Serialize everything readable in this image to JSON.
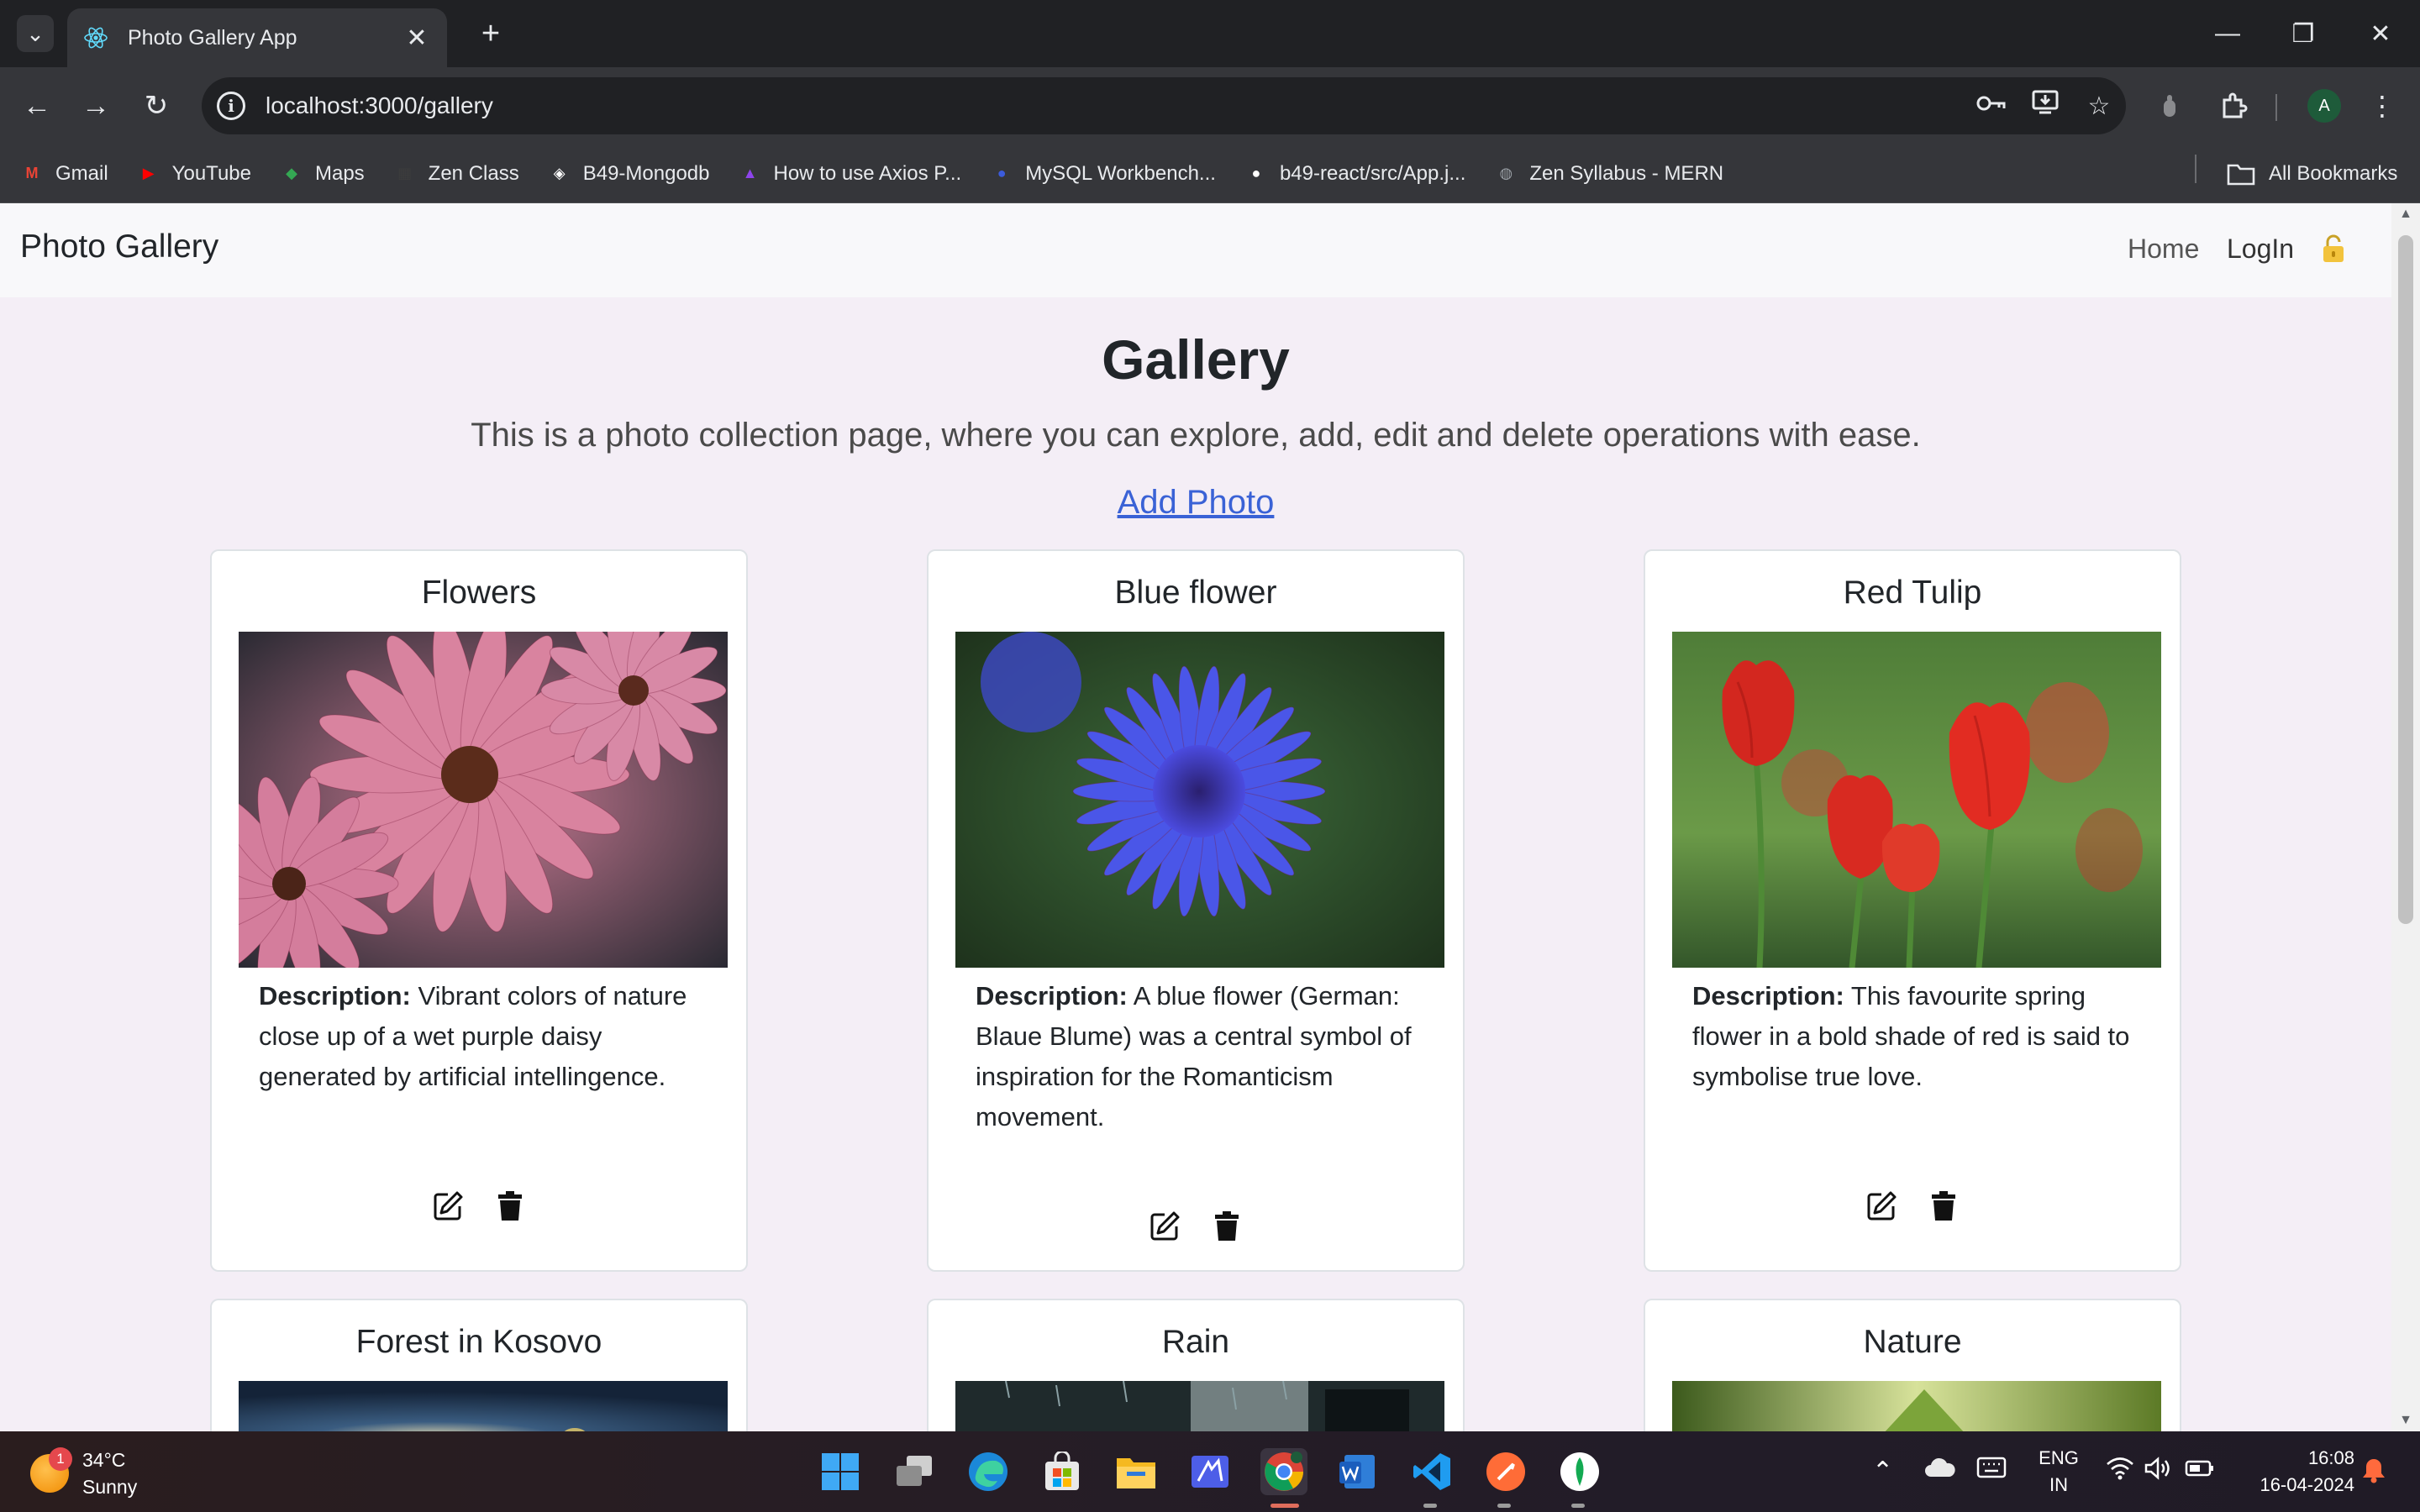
{
  "browser": {
    "tab_title": "Photo Gallery App",
    "tab_close": "✕",
    "new_tab": "+",
    "url": "localhost:3000/gallery",
    "bookmarks": [
      {
        "label": "Gmail",
        "icon": "gmail-icon",
        "color": "#ea4335"
      },
      {
        "label": "YouTube",
        "icon": "youtube-icon",
        "color": "#ff0000"
      },
      {
        "label": "Maps",
        "icon": "maps-icon",
        "color": "#34a853"
      },
      {
        "label": "Zen Class",
        "icon": "zen-class-icon",
        "color": "#3c3c3c"
      },
      {
        "label": "B49-Mongodb",
        "icon": "codepen-icon",
        "color": "#ffffff"
      },
      {
        "label": "How to use Axios P...",
        "icon": "rocket-icon",
        "color": "#8e44ec"
      },
      {
        "label": "MySQL Workbench...",
        "icon": "globe-blue-icon",
        "color": "#3b5bdb"
      },
      {
        "label": "b49-react/src/App.j...",
        "icon": "github-icon",
        "color": "#ffffff"
      },
      {
        "label": "Zen Syllabus - MERN",
        "icon": "globe-icon",
        "color": "#9aa0a6"
      }
    ],
    "all_bookmarks": "All Bookmarks",
    "profile_initial": "A"
  },
  "navbar": {
    "brand": "Photo Gallery",
    "home": "Home",
    "login": "LogIn"
  },
  "main": {
    "title": "Gallery",
    "subtitle": "This is a photo collection page, where you can explore, add, edit and delete operations with ease.",
    "add_photo": "Add Photo"
  },
  "cards": [
    {
      "title": "Flowers",
      "desc_label": "Description:",
      "desc": " Vibrant colors of nature close up of a wet purple daisy generated by artificial intellingence."
    },
    {
      "title": "Blue flower",
      "desc_label": "Description:",
      "desc": " A blue flower (German: Blaue Blume) was a central symbol of inspiration for the Romanticism movement."
    },
    {
      "title": "Red Tulip",
      "desc_label": "Description:",
      "desc": " This favourite spring flower in a bold shade of red is said to symbolise true love."
    },
    {
      "title": "Forest in Kosovo"
    },
    {
      "title": "Rain"
    },
    {
      "title": "Nature"
    }
  ],
  "taskbar": {
    "temperature": "34°C",
    "condition": "Sunny",
    "notification_count": "1",
    "language": "ENG",
    "region": "IN",
    "time": "16:08",
    "date": "16-04-2024"
  },
  "colors": {
    "link": "#3a62d6",
    "page_bg": "#f4eef6",
    "navbar_bg": "#f8f8fa"
  }
}
